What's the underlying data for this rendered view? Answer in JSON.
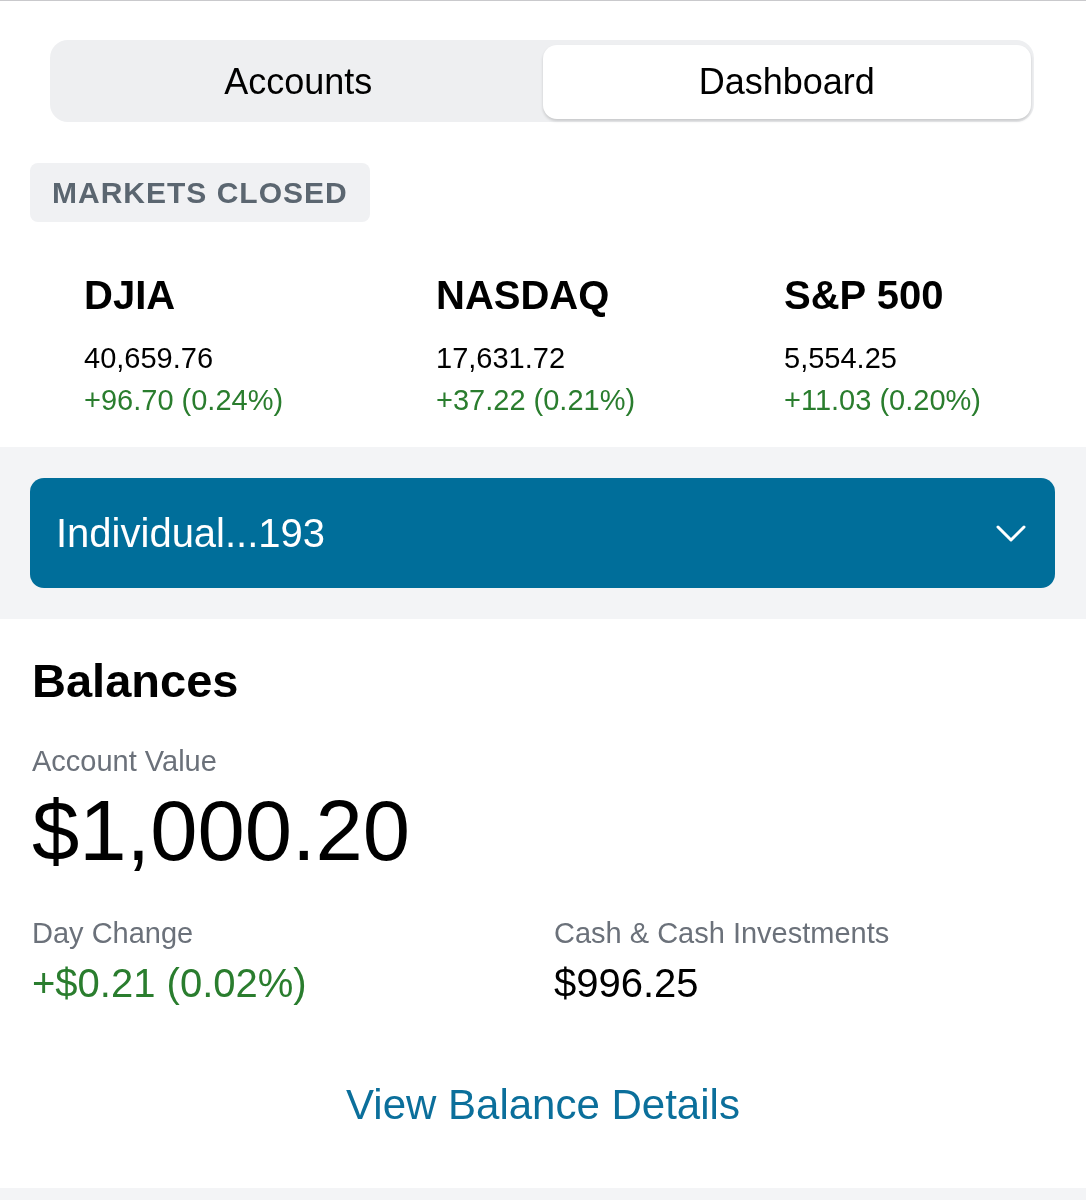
{
  "tabs": [
    {
      "label": "Accounts",
      "selected": false
    },
    {
      "label": "Dashboard",
      "selected": true
    }
  ],
  "market_status": "MARKETS CLOSED",
  "indices": [
    {
      "name": "DJIA",
      "value": "40,659.76",
      "change": "+96.70 (0.24%)"
    },
    {
      "name": "NASDAQ",
      "value": "17,631.72",
      "change": "+37.22 (0.21%)"
    },
    {
      "name": "S&P 500",
      "value": "5,554.25",
      "change": "+11.03 (0.20%)"
    }
  ],
  "account_selector": {
    "label": "Individual...193",
    "expanded": false
  },
  "balances": {
    "title": "Balances",
    "account_value": {
      "label": "Account Value",
      "value": "$1,000.20"
    },
    "day_change": {
      "label": "Day Change",
      "value": "+$0.21 (0.02%)"
    },
    "cash": {
      "label": "Cash & Cash Investments",
      "value": "$996.25"
    },
    "link": "View Balance Details"
  }
}
